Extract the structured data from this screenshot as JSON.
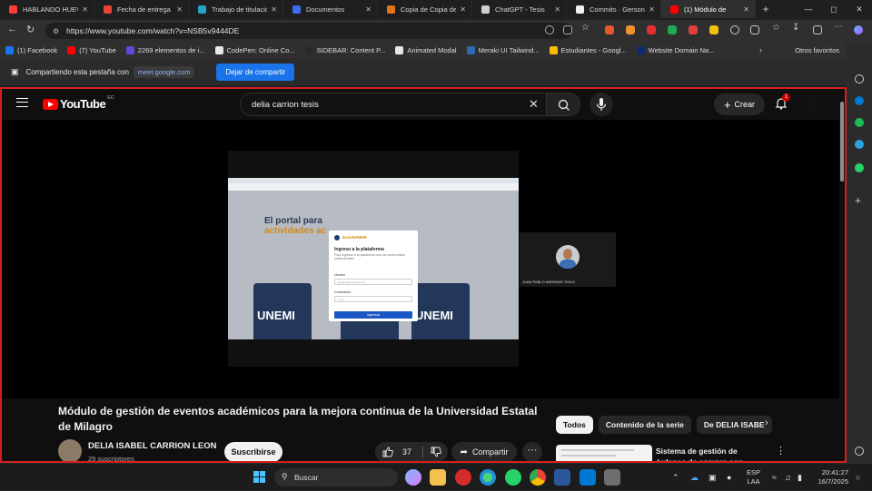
{
  "browser": {
    "tabs": [
      {
        "title": "HABLANDO HUEVA",
        "color": "#ff3b3b",
        "active": false
      },
      {
        "title": "Fecha de entrega d",
        "color": "#ea4335",
        "active": false
      },
      {
        "title": "Trabajo de titulació",
        "color": "#23a3c9",
        "active": false
      },
      {
        "title": "Documentos",
        "color": "#3b6ee8",
        "active": false
      },
      {
        "title": "Copia de Copia de",
        "color": "#e0751a",
        "active": false
      },
      {
        "title": "ChatGPT - Tesis",
        "color": "#d0d0d0",
        "active": false
      },
      {
        "title": "Commits · GersonS",
        "color": "#f0f0f0",
        "active": false
      },
      {
        "title": "(1) Módulo de",
        "color": "#ff0000",
        "active": true
      }
    ],
    "new_tab": "+",
    "url": "https://www.youtube.com/watch?v=NSB5v9444DE",
    "bookmarks": [
      {
        "label": "(1) Facebook",
        "color": "#1877f2"
      },
      {
        "label": "(7) YouTube",
        "color": "#ff0000"
      },
      {
        "label": "2269 elementos de i...",
        "color": "#5b4bd6"
      },
      {
        "label": "CodePen: Online Co...",
        "color": "#e8e8e8"
      },
      {
        "label": "SIDEBAR: Content P...",
        "color": "#2a2a2a"
      },
      {
        "label": "Animated Modal",
        "color": "#e8e8e8"
      },
      {
        "label": "Meraki UI Tailwind...",
        "color": "#2b6cb0"
      },
      {
        "label": "Estudiantes - Googl...",
        "color": "#fbbc04"
      },
      {
        "label": "Website Domain Na...",
        "color": "#0d2b6b"
      }
    ],
    "other_bookmarks": "Otros favoritos",
    "sharing_text": "Compartiendo esta pestaña con",
    "sharing_host": "meet.google.com",
    "stop_sharing": "Dejar de compartir"
  },
  "youtube": {
    "country": "EC",
    "logo_text": "YouTube",
    "search_query": "delia carrion tesis",
    "create_label": "Crear",
    "notifications": "1",
    "video": {
      "title": "Módulo de gestión de eventos académicos para la mejora continua de la Universidad Estatal de Milagro",
      "channel": "DELIA ISABEL CARRION LEON",
      "subscribers": "29 suscriptores",
      "subscribe_label": "Suscribirse",
      "likes": "37",
      "share_label": "Compartir",
      "more": "···"
    },
    "shared_screen": {
      "hero_line1": "El portal para",
      "hero_line2": "actividades ac",
      "brand": "UNEMI",
      "modal_brand": "EventUNEMI",
      "modal_title": "Ingreso a la plataforma",
      "modal_sub": "Para ingresar a la plataforma usa tus credenciales institucionales",
      "user_label": "Usuario",
      "user_placeholder": "usuario@unemi.edu.ec",
      "pass_label": "Contraseña",
      "pass_placeholder": "••••••••",
      "login_label": "Ingresar"
    },
    "participant_name": "JUAN PABLO ANDRADE SOLIS",
    "chips": [
      {
        "label": "Todos",
        "selected": true
      },
      {
        "label": "Contenido de la serie",
        "selected": false
      },
      {
        "label": "De DELIA ISABE",
        "selected": false
      }
    ],
    "recommendation_title": "Sistema de gestión de órdenes de compra con geolocalizació"
  },
  "taskbar": {
    "search_label": "Buscar",
    "language": "ESP",
    "region": "LAA",
    "time": "20:41:27",
    "date": "16/7/2025"
  }
}
